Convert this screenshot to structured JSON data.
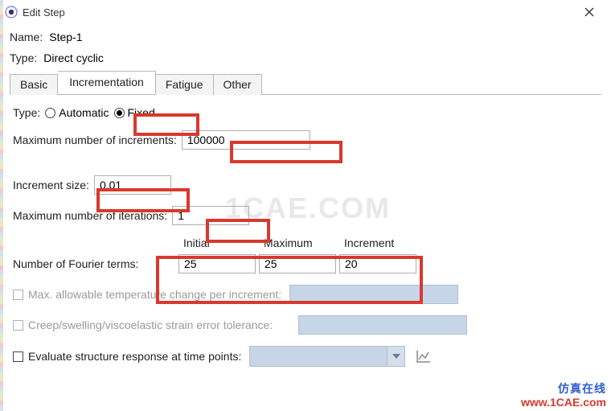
{
  "window": {
    "title": "Edit Step"
  },
  "header": {
    "name_label": "Name:",
    "name_value": "Step-1",
    "type_label": "Type:",
    "type_value": "Direct cyclic"
  },
  "tabs": {
    "basic": "Basic",
    "incrementation": "Incrementation",
    "fatigue": "Fatigue",
    "other": "Other",
    "active": "incrementation"
  },
  "inc": {
    "type_label": "Type:",
    "automatic_label": "Automatic",
    "fixed_label": "Fixed",
    "type_selected": "fixed",
    "max_increments_label": "Maximum number of increments:",
    "max_increments_value": "100000",
    "increment_size_label": "Increment size:",
    "increment_size_value": "0.01",
    "max_iterations_label": "Maximum number of iterations:",
    "max_iterations_value": "1",
    "col_initial": "Initial",
    "col_maximum": "Maximum",
    "col_increment": "Increment",
    "fourier_label": "Number of Fourier terms:",
    "fourier_initial": "25",
    "fourier_maximum": "25",
    "fourier_increment": "20",
    "max_temp_label": "Max. allowable temperature change per  increment:",
    "creep_label": "Creep/swelling/viscoelastic strain error tolerance:",
    "eval_label": "Evaluate structure response at time points:"
  },
  "branding": {
    "wm_text": "1CAE.COM",
    "zh": "仿真在线",
    "url": "www.1CAE.com"
  }
}
